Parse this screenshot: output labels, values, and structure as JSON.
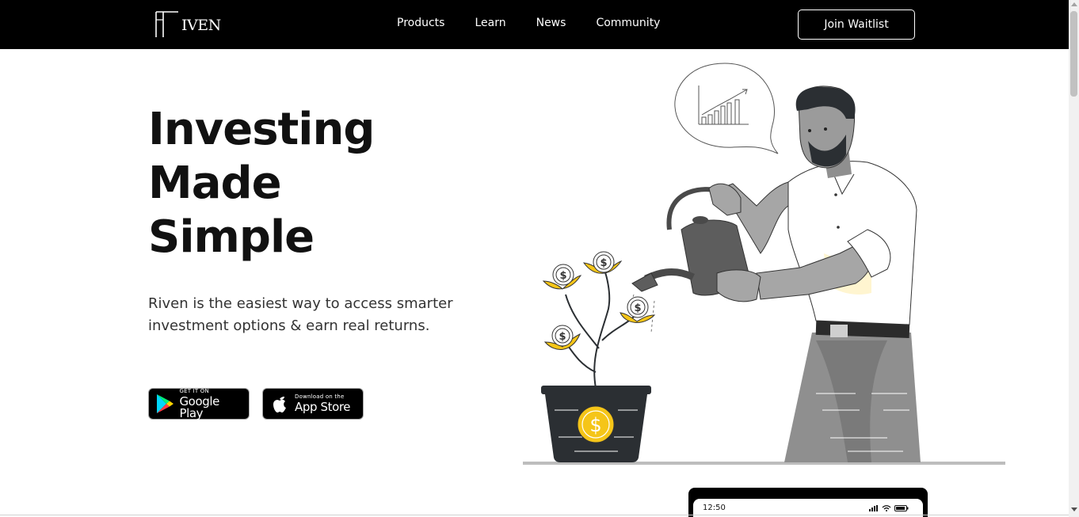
{
  "brand": {
    "logo_text": "IVEN"
  },
  "nav": {
    "items": [
      {
        "label": "Products"
      },
      {
        "label": "Learn"
      },
      {
        "label": "News"
      },
      {
        "label": "Community"
      }
    ],
    "cta_label": "Join Waitlist"
  },
  "hero": {
    "title_lines": [
      "Investing",
      "Made",
      "Simple"
    ],
    "subtitle": "Riven is the easiest way to access smarter investment options & earn real returns."
  },
  "stores": {
    "google_small": "GET IT ON",
    "google_big": "Google Play",
    "apple_small": "Download on the",
    "apple_big": "App Store"
  },
  "phone": {
    "time": "12:50"
  },
  "colors": {
    "nav_bg": "#000000",
    "accent_yellow": "#f5c518",
    "pot": "#2b2f33"
  },
  "icons": [
    "google-play-icon",
    "apple-icon",
    "dollar-coin-icon",
    "growth-chart-icon"
  ]
}
